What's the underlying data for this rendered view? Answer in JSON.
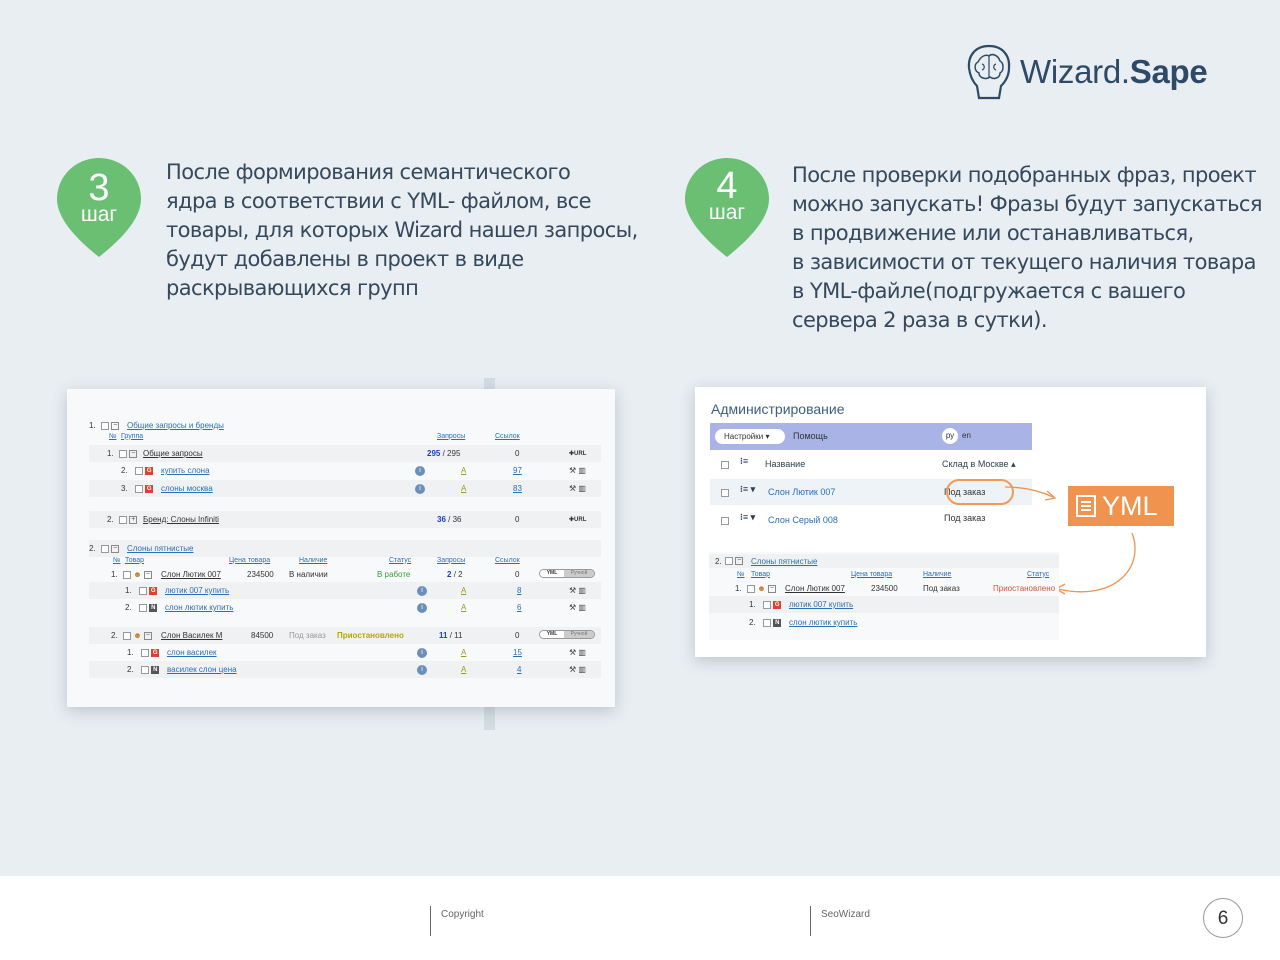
{
  "brand": {
    "name_part1": "Wizard.",
    "name_part2": "Sape"
  },
  "steps": [
    {
      "number": "3",
      "word": "шаг",
      "lines": [
        "После формирования семантического",
        "ядра в соответствии с YML- файлом, все",
        "товары, для которых Wizard нашел запросы,",
        "будут добавлены в проект в виде",
        "раскрывающихся групп"
      ]
    },
    {
      "number": "4",
      "word": "шаг",
      "lines": [
        "После проверки подобранных фраз, проект",
        "можно запускать! Фразы будут запускаться",
        "в продвижение или останавливаться,",
        "в зависимости от текущего наличия товара",
        "в YML-файле(подгружается с вашего",
        "сервера 2 раза в сутки)."
      ]
    }
  ],
  "colors": {
    "pin": "#6bbf73",
    "accent": "#f0934e",
    "link": "#2a6fb5"
  },
  "left_screen": {
    "g1_num": "1.",
    "g1_title": "Общие запросы и бренды",
    "h_no": "№",
    "h_group": "Группа",
    "h_req": "Запросы",
    "h_links": "Ссылок",
    "r1_num": "1.",
    "r1_title": "Общие запросы",
    "r1_req": "295",
    "r1_req_total": "/ 295",
    "r1_links": "0",
    "r1_url": "✚URL",
    "r1a_num": "2.",
    "r1a_text": "купить слона",
    "r1a_a": "A",
    "r1a_links": "97",
    "r1b_num": "3.",
    "r1b_text": "слоны москва",
    "r1b_a": "A",
    "r1b_links": "83",
    "r2_num": "2.",
    "r2_title": "Бренд: Слоны Infiniti",
    "r2_req": "36",
    "r2_req_total": "/ 36",
    "r2_links": "0",
    "r2_url": "✚URL",
    "g2_num": "2.",
    "g2_title": "Слоны пятнистые",
    "h2_no": "№",
    "h2_item": "Товар",
    "h2_price": "Цена товара",
    "h2_avail": "Наличие",
    "h2_status": "Статус",
    "h2_req": "Запросы",
    "h2_links": "Ссылок",
    "p1_num": "1.",
    "p1_title": "Слон Лютик 007",
    "p1_price": "234500",
    "p1_avail": "В наличии",
    "p1_status": "В работе",
    "p1_req": "2",
    "p1_req_total": "/ 2",
    "p1_links": "0",
    "toggle_on": "YML",
    "toggle_off": "Ручной",
    "p1a_num": "1.",
    "p1a_text": "лютик 007 купить",
    "p1a_a": "A",
    "p1a_links": "8",
    "p1b_num": "2.",
    "p1b_text": "слон лютик купить",
    "p1b_a": "A",
    "p1b_links": "6",
    "p2_num": "2.",
    "p2_title": "Слон Василек М",
    "p2_price": "84500",
    "p2_avail": "Под заказ",
    "p2_status": "Приостановлено",
    "p2_req": "11",
    "p2_req_total": "/ 11",
    "p2_links": "0",
    "p2a_num": "1.",
    "p2a_text": "слон василек",
    "p2a_a": "A",
    "p2a_links": "15",
    "p2b_num": "2.",
    "p2b_text": "василек слон цена",
    "p2b_a": "A",
    "p2b_links": "4",
    "g_icon": "G",
    "n_icon": "N"
  },
  "right_screen": {
    "title": "Администрирование",
    "settings": "Настройки",
    "help": "Помощь",
    "lang_active": "ру",
    "lang_other": "en",
    "col_name": "Название",
    "col_stock": "Склад в Москве",
    "row1_name": "Слон Лютик 007",
    "row1_stock": "Под заказ",
    "row2_name": "Слон Серый 008",
    "row2_stock": "Под заказ",
    "yml_label": "YML",
    "g_num": "2.",
    "g_title": "Слоны пятнистые",
    "h_no": "№",
    "h_item": "Товар",
    "h_price": "Цена товара",
    "h_avail": "Наличие",
    "h_status": "Статус",
    "p_num": "1.",
    "p_title": "Слон Лютик 007",
    "p_price": "234500",
    "p_avail": "Под заказ",
    "p_status": "Приостановлено",
    "k1_num": "1.",
    "k1_text": "лютик 007 купить",
    "k2_num": "2.",
    "k2_text": "слон лютик купить",
    "g_icon": "G",
    "n_icon": "N"
  },
  "footer": {
    "copyright": "Copyright",
    "company": "SeoWizard",
    "page": "6"
  }
}
